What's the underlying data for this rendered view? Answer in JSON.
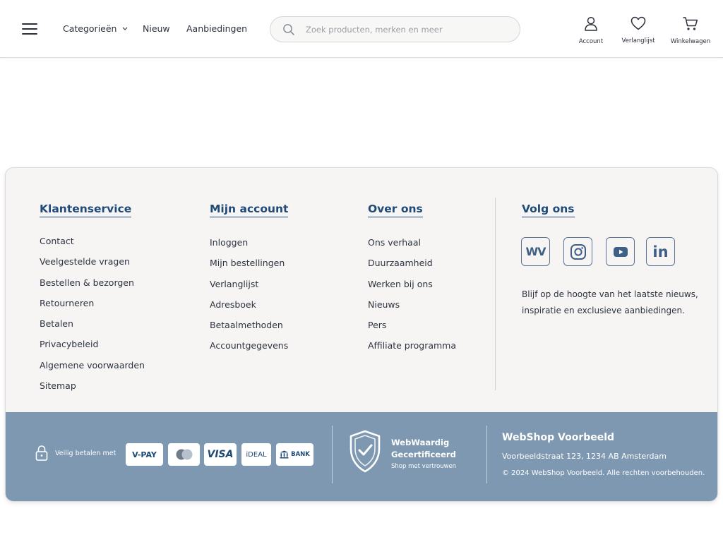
{
  "header": {
    "nav": [
      {
        "label": "Categorieën"
      },
      {
        "label": "Nieuw"
      },
      {
        "label": "Aanbiedingen"
      }
    ],
    "search_placeholder": "Zoek producten, merken en meer",
    "actions": {
      "account": "Account",
      "wishlist": "Verlanglijst",
      "cart": "Winkelwagen"
    }
  },
  "footer": {
    "columns": [
      {
        "heading": "Klantenservice",
        "links": [
          "Contact",
          "Veelgestelde vragen",
          "Bestellen & bezorgen",
          "Retourneren",
          "Betalen",
          "Privacybeleid",
          "Algemene voorwaarden",
          "Sitemap"
        ]
      },
      {
        "heading": "Mijn account",
        "links": [
          "Inloggen",
          "Mijn bestellingen",
          "Verlanglijst",
          "Adresboek",
          "Betaalmethoden",
          "Accountgegevens"
        ]
      },
      {
        "heading": "Over ons",
        "links": [
          "Ons verhaal",
          "Duurzaamheid",
          "Werken bij ons",
          "Nieuws",
          "Pers",
          "Affiliate programma"
        ]
      }
    ],
    "follow": {
      "heading": "Volg ons",
      "socials": [
        {
          "icon": "wv-icon",
          "text": "WV"
        },
        {
          "icon": "instagram-icon"
        },
        {
          "icon": "youtube-icon"
        },
        {
          "icon": "linkedin-icon",
          "text": "in"
        }
      ],
      "text": "Blijf op de hoogte van het laatste nieuws, inspiratie en exclusieve aanbiedingen."
    }
  },
  "bottom": {
    "secure_label": "Veilig betalen met",
    "payments": {
      "vpay": "V-PAY",
      "visa": "VISA",
      "ideal": "iDEAL",
      "bank": "BANK"
    },
    "cert_title_line1": "WebWaardig",
    "cert_title_line2": "Gecertificeerd",
    "cert_sub": "Shop met vertrouwen",
    "shop_name": "WebShop Voorbeeld",
    "address": "Voorbeeldstraat 123, 1234 AB Amsterdam",
    "copyright": "© 2024 WebShop Voorbeeld. Alle rechten voorbehouden."
  },
  "colors": {
    "brand_blue": "#1f4a78",
    "footer_band": "#7e98b1",
    "footer_bg": "#f6f5f3"
  }
}
